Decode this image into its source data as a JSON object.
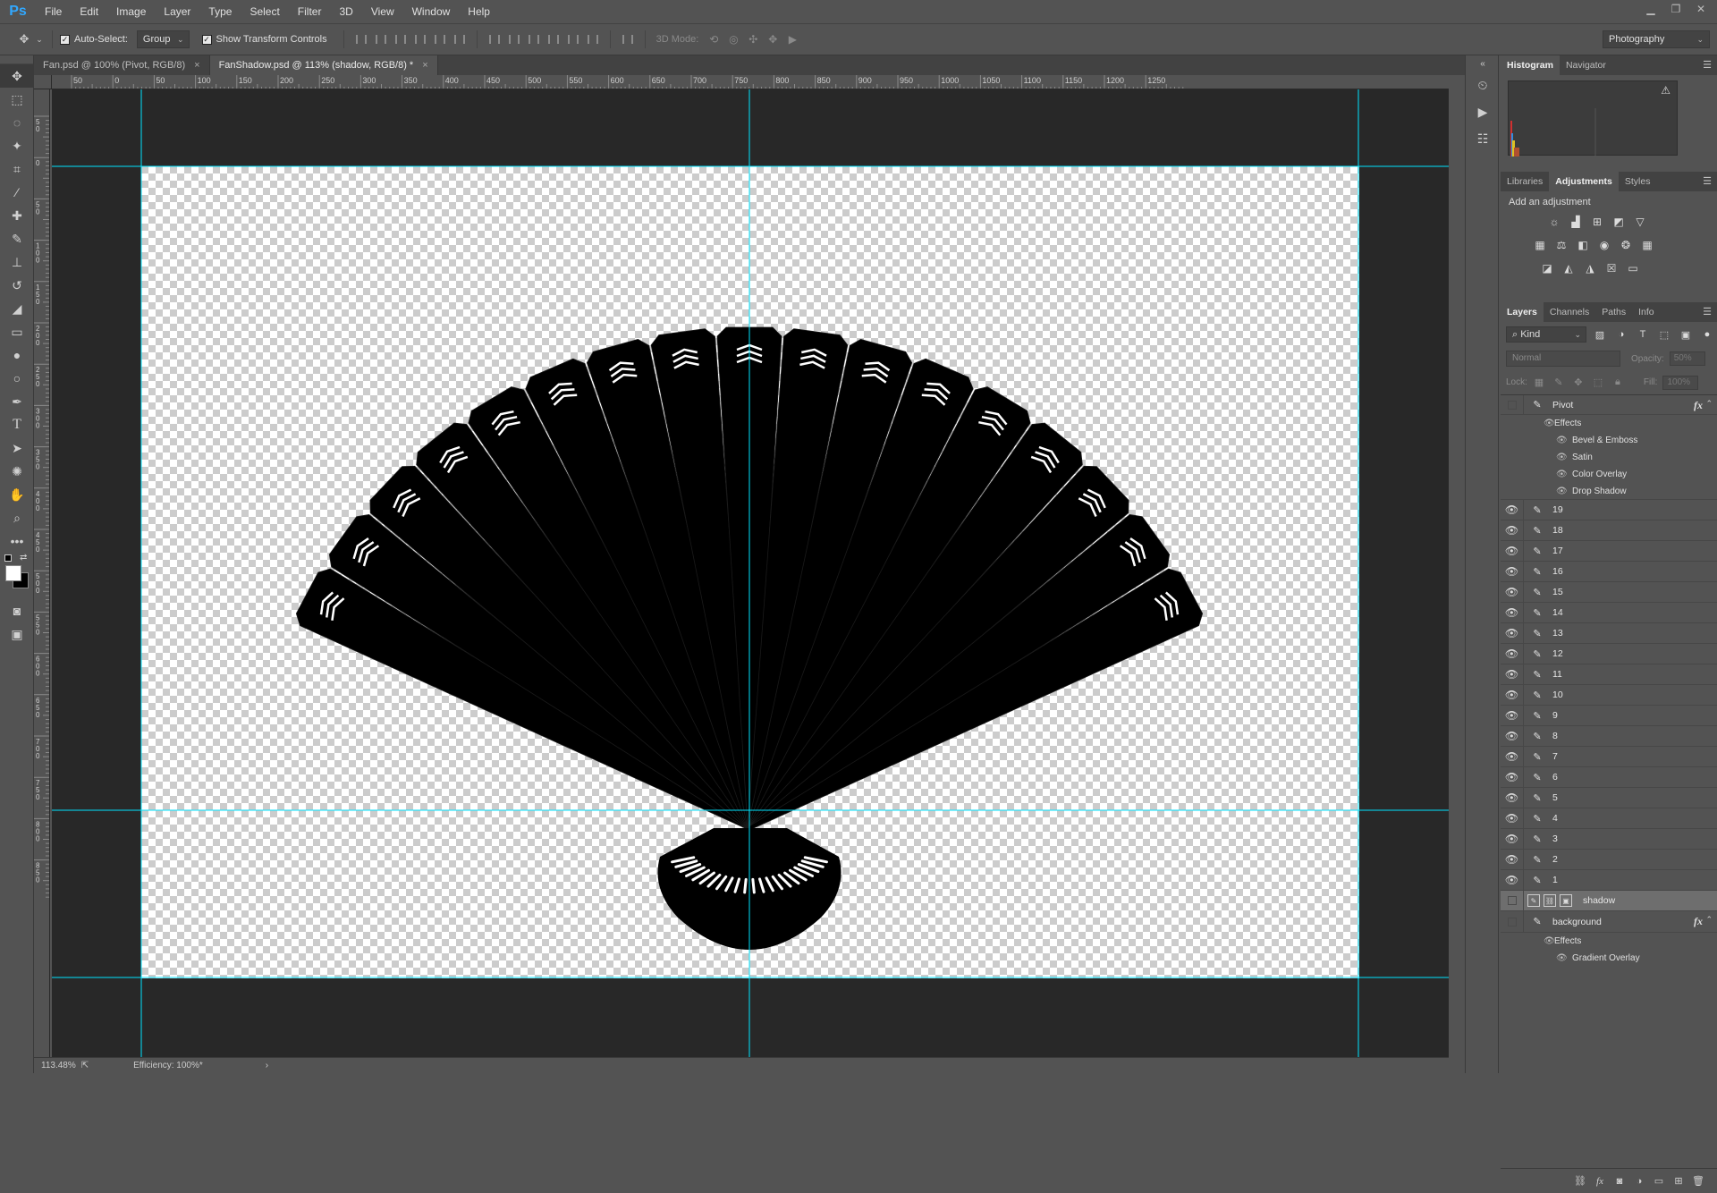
{
  "app": {
    "logo": "Ps"
  },
  "menu": [
    "File",
    "Edit",
    "Image",
    "Layer",
    "Type",
    "Select",
    "Filter",
    "3D",
    "View",
    "Window",
    "Help"
  ],
  "options": {
    "auto_select_label": "Auto-Select:",
    "auto_select_value": "Group",
    "show_transform_label": "Show Transform Controls",
    "mode3d_label": "3D Mode:",
    "workspace": "Photography"
  },
  "tabs": [
    {
      "label": "Fan.psd @ 100% (Pivot, RGB/8)",
      "close": "×"
    },
    {
      "label": "FanShadow.psd @ 113% (shadow, RGB/8) *",
      "close": "×"
    }
  ],
  "ruler": {
    "h_ticks": [
      "50",
      "0",
      "50",
      "100",
      "150",
      "200",
      "250",
      "300",
      "350",
      "400",
      "450",
      "500",
      "550",
      "600",
      "650",
      "700",
      "750",
      "800",
      "850",
      "900",
      "950",
      "1000",
      "1050",
      "1100",
      "1150",
      "1200",
      "1250"
    ],
    "v_ticks": [
      "50",
      "0",
      "50",
      "100",
      "150",
      "200",
      "250",
      "300",
      "350",
      "400",
      "450",
      "500",
      "550",
      "600",
      "650",
      "700",
      "750",
      "800",
      "850"
    ]
  },
  "status": {
    "zoom": "113.48%",
    "info": "Efficiency: 100%*"
  },
  "panels": {
    "histogram_tabs": [
      "Histogram",
      "Navigator"
    ],
    "adjust_tabs": [
      "Libraries",
      "Adjustments",
      "Styles"
    ],
    "adjust_title": "Add an adjustment",
    "layers_tabs": [
      "Layers",
      "Channels",
      "Paths",
      "Info"
    ],
    "kind_label": "Kind",
    "blend_mode": "Normal",
    "opacity_label": "Opacity:",
    "opacity_value": "50%",
    "lock_label": "Lock:",
    "fill_label": "Fill:",
    "fill_value": "100%"
  },
  "layers": {
    "pivot": {
      "name": "Pivot",
      "effects_label": "Effects",
      "effects": [
        "Bevel & Emboss",
        "Satin",
        "Color Overlay",
        "Drop Shadow"
      ]
    },
    "numbered": [
      "19",
      "18",
      "17",
      "16",
      "15",
      "14",
      "13",
      "12",
      "11",
      "10",
      "9",
      "8",
      "7",
      "6",
      "5",
      "4",
      "3",
      "2",
      "1"
    ],
    "shadow": {
      "name": "shadow"
    },
    "background": {
      "name": "background",
      "effects_label": "Effects",
      "effects": [
        "Gradient Overlay"
      ]
    }
  },
  "colors": {
    "guide": "#00e5ff",
    "foreground": "#ffffff",
    "background": "#000000",
    "canvas_bg": "#282828"
  }
}
